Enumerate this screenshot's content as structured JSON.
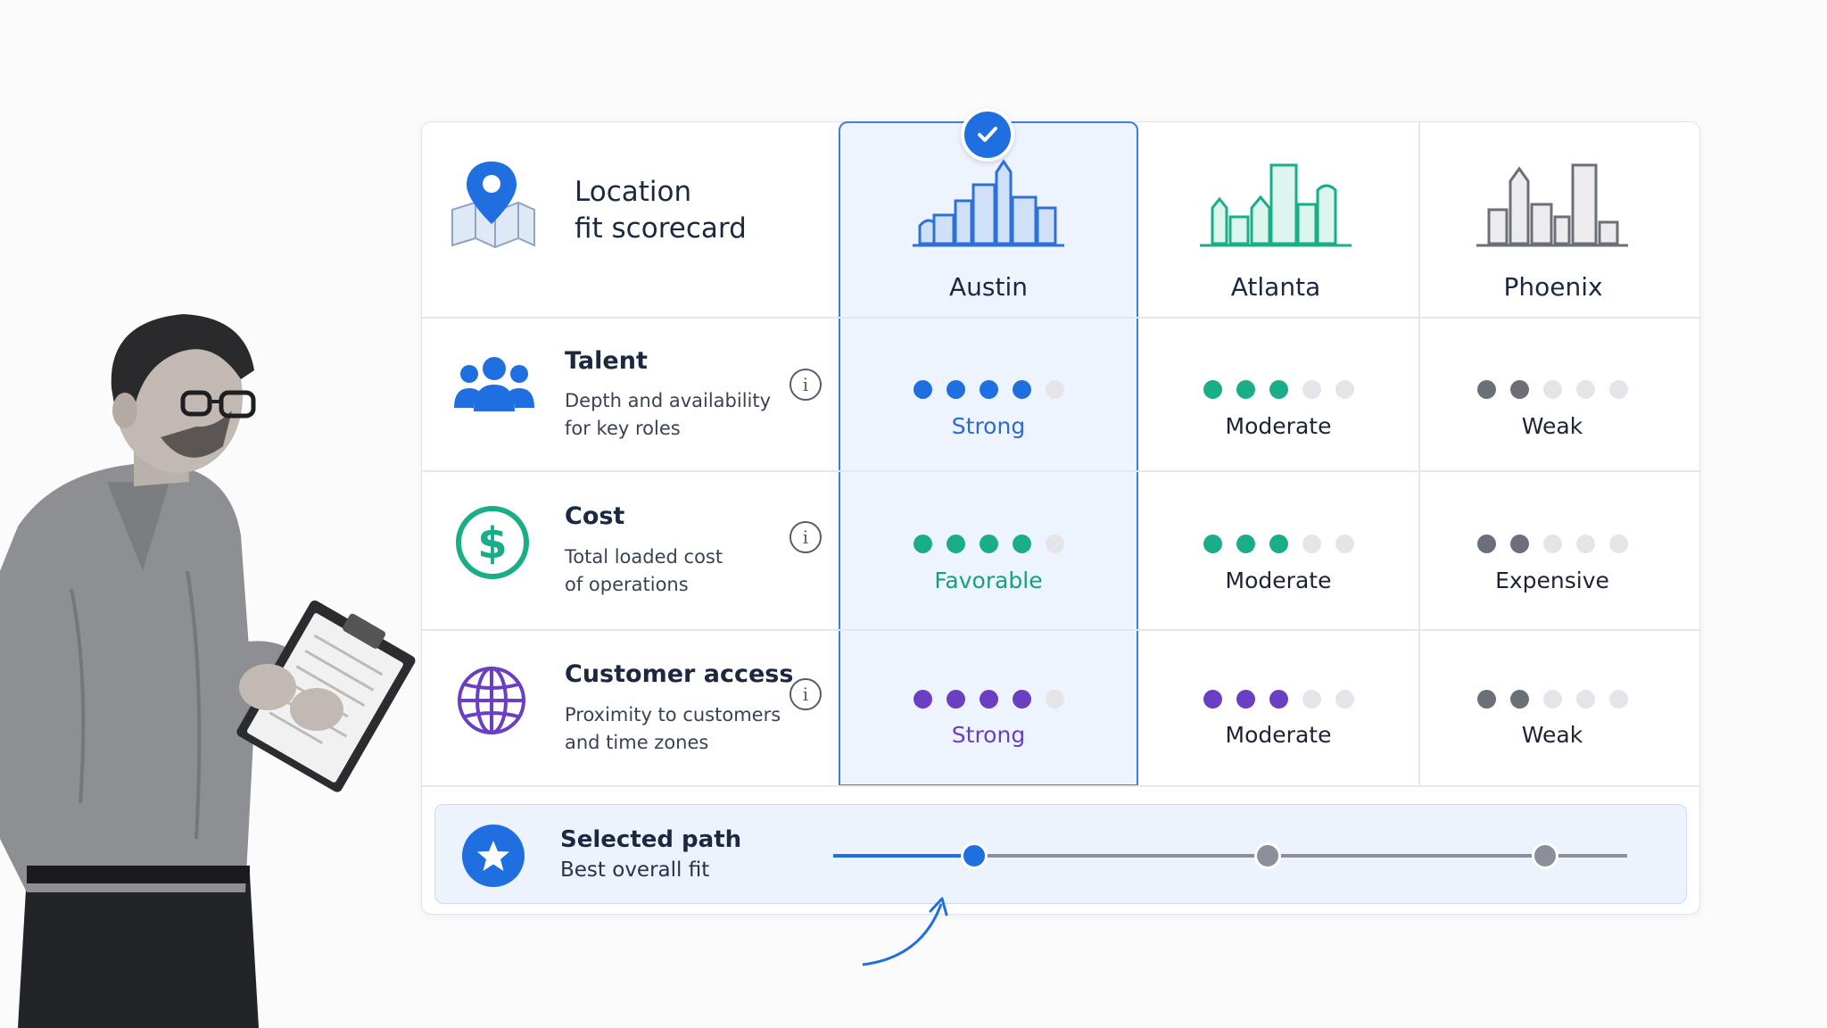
{
  "scorecard": {
    "title_line1": "Location",
    "title_line2": "fit scorecard",
    "cities": [
      {
        "name": "Austin",
        "selected": true,
        "color": "#2f6fd8"
      },
      {
        "name": "Atlanta",
        "selected": false,
        "color": "#1aae88"
      },
      {
        "name": "Phoenix",
        "selected": false,
        "color": "#6b6f78"
      }
    ],
    "criteria": [
      {
        "title": "Talent",
        "desc_line1": "Depth and availability",
        "desc_line2": "for key roles",
        "icon": "people-icon",
        "scores": [
          {
            "filled": 4,
            "of": 5,
            "label": "Strong",
            "color": "#1f6fe0",
            "label_color": "#2a6bd6"
          },
          {
            "filled": 3,
            "of": 5,
            "label": "Moderate",
            "color": "#1aae88",
            "label_color": "#1c2333"
          },
          {
            "filled": 2,
            "of": 5,
            "label": "Weak",
            "color": "#6b6f78",
            "label_color": "#1c2333"
          }
        ]
      },
      {
        "title": "Cost",
        "desc_line1": "Total loaded cost",
        "desc_line2": "of operations",
        "icon": "dollar-icon",
        "scores": [
          {
            "filled": 4,
            "of": 5,
            "label": "Favorable",
            "color": "#1aae88",
            "label_color": "#16a07c"
          },
          {
            "filled": 3,
            "of": 5,
            "label": "Moderate",
            "color": "#1aae88",
            "label_color": "#1c2333"
          },
          {
            "filled": 2,
            "of": 5,
            "label": "Expensive",
            "color": "#6b6f78",
            "label_color": "#1c2333"
          }
        ]
      },
      {
        "title": "Customer access",
        "desc_line1": "Proximity to customers",
        "desc_line2": "and time zones",
        "icon": "globe-icon",
        "scores": [
          {
            "filled": 4,
            "of": 5,
            "label": "Strong",
            "color": "#6a3fc4",
            "label_color": "#6a3fc4"
          },
          {
            "filled": 3,
            "of": 5,
            "label": "Moderate",
            "color": "#6a3fc4",
            "label_color": "#1c2333"
          },
          {
            "filled": 2,
            "of": 5,
            "label": "Weak",
            "color": "#6b6f78",
            "label_color": "#1c2333"
          }
        ]
      }
    ],
    "selected_path": {
      "title": "Selected path",
      "subtitle": "Best overall fit",
      "selected_index": 0,
      "icon": "star-icon"
    }
  }
}
